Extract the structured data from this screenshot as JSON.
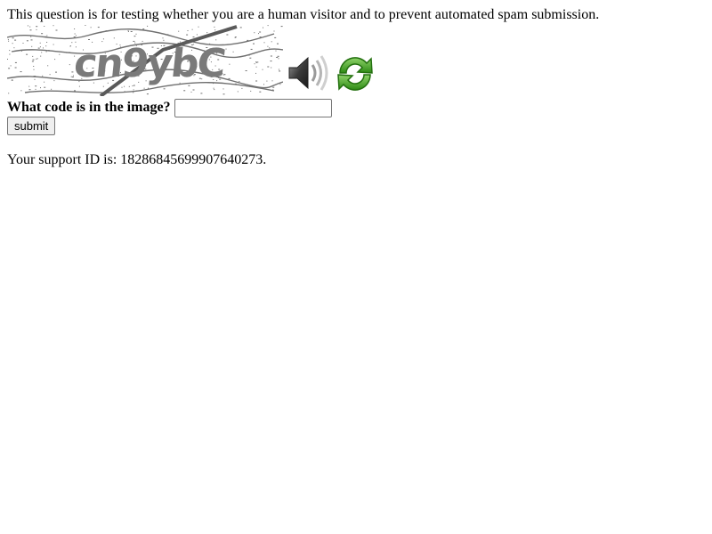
{
  "page": {
    "intro_text": "This question is for testing whether you are a human visitor and to prevent automated spam submission.",
    "captcha": {
      "image_alt": "captcha image",
      "image_code_text": "cn9ybC",
      "audio_icon": "speaker-icon",
      "refresh_icon": "refresh-icon"
    },
    "question_label": "What code is in the image?",
    "answer_input": {
      "value": "",
      "placeholder": ""
    },
    "submit_label": "submit",
    "support_text": "Your support ID is: 18286845699907640273."
  },
  "colors": {
    "refresh_green": "#3a9a1e",
    "captcha_ink": "#6f6f6f"
  }
}
